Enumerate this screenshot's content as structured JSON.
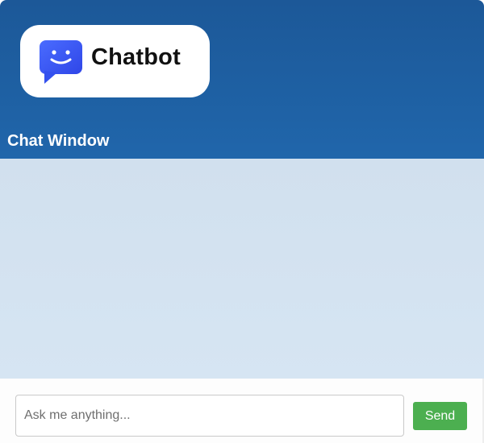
{
  "header": {
    "logo_text": "Chatbot",
    "logo_icon": "chat-bubble-smiley-icon",
    "window_title": "Chat Window"
  },
  "chat": {
    "messages": []
  },
  "composer": {
    "placeholder": "Ask me anything...",
    "value": "",
    "send_label": "Send"
  },
  "colors": {
    "header": "#1f5fa3",
    "chat_background": "#d4e3f1",
    "send_button": "#4caf50",
    "logo_icon": "#3b5cf5"
  }
}
